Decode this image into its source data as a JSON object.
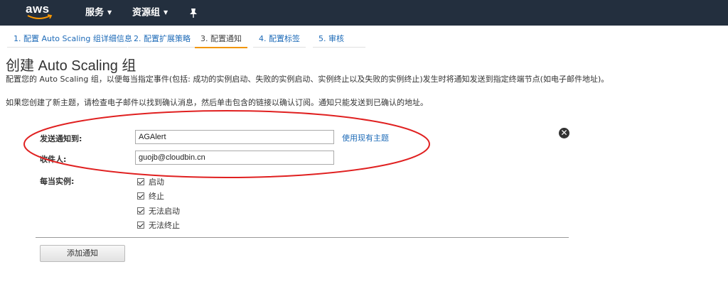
{
  "nav": {
    "logo": "aws",
    "services": "服务",
    "resource_groups": "资源组",
    "pin_icon": "pin-icon"
  },
  "steps": [
    {
      "label": "1. 配置 Auto Scaling 组详细信息"
    },
    {
      "label": "2. 配置扩展策略"
    },
    {
      "label": "3. 配置通知"
    },
    {
      "label": "4. 配置标签"
    },
    {
      "label": "5. 审核"
    }
  ],
  "page": {
    "title": "创建 Auto Scaling 组",
    "description": "配置您的 Auto Scaling 组，以便每当指定事件(包括: 成功的实例启动、失败的实例启动、实例终止以及失败的实例终止)发生时将通知发送到指定终端节点(如电子邮件地址)。",
    "note": "如果您创建了新主题，请检查电子邮件以找到确认消息，然后单击包含的链接以确认订阅。通知只能发送到已确认的地址。"
  },
  "form": {
    "send_to_label": "发送通知到:",
    "send_to_value": "AGAlert",
    "use_existing_topic": "使用现有主题",
    "recipient_label": "收件人:",
    "recipient_value": "guojb@cloudbin.cn",
    "whenever_label": "每当实例:",
    "options": [
      {
        "label": "启动",
        "checked": true
      },
      {
        "label": "终止",
        "checked": true
      },
      {
        "label": "无法启动",
        "checked": true
      },
      {
        "label": "无法终止",
        "checked": true
      }
    ],
    "add_notification": "添加通知"
  },
  "colors": {
    "nav_bg": "#232f3e",
    "link": "#1e6bb8",
    "active_step": "#f29600",
    "annotation": "#e02020"
  }
}
